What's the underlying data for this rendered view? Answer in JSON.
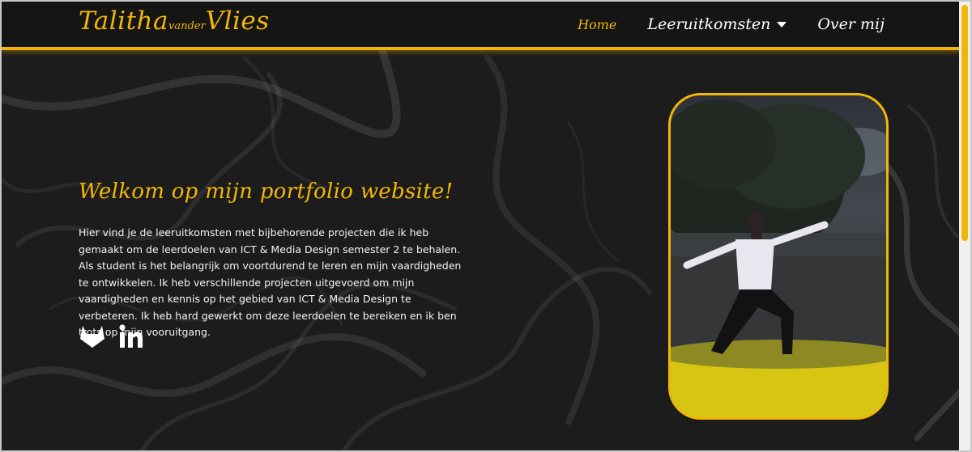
{
  "header": {
    "logo": {
      "first": "Talitha",
      "middle": "vander",
      "last": "Vlies"
    },
    "nav": [
      {
        "label": "Home",
        "active": true
      },
      {
        "label": "Leeruitkomsten",
        "has_dropdown": true
      },
      {
        "label": "Over mij"
      }
    ]
  },
  "hero": {
    "title": "Welkom op mijn portfolio website!",
    "text": "Hier vind je de leeruitkomsten met bijbehorende projecten die ik heb gemaakt om de leerdoelen van ICT & Media Design semester 2 te behalen. Als student is het belangrijk om voortdurend te leren en mijn vaardigheden te ontwikkelen. Ik heb verschillende projecten uitgevoerd om mijn vaardigheden en kennis op het gebied van ICT & Media Design te verbeteren. Ik heb hard gewerkt om deze leerdoelen te bereiken en ik ben trots op mijn vooruitgang.",
    "socials": [
      {
        "icon": "gitlab-icon"
      },
      {
        "icon": "linkedin-icon"
      }
    ]
  },
  "colors": {
    "accent": "#f2b705",
    "background": "#1c1c1c",
    "text": "#f4f4f4"
  }
}
